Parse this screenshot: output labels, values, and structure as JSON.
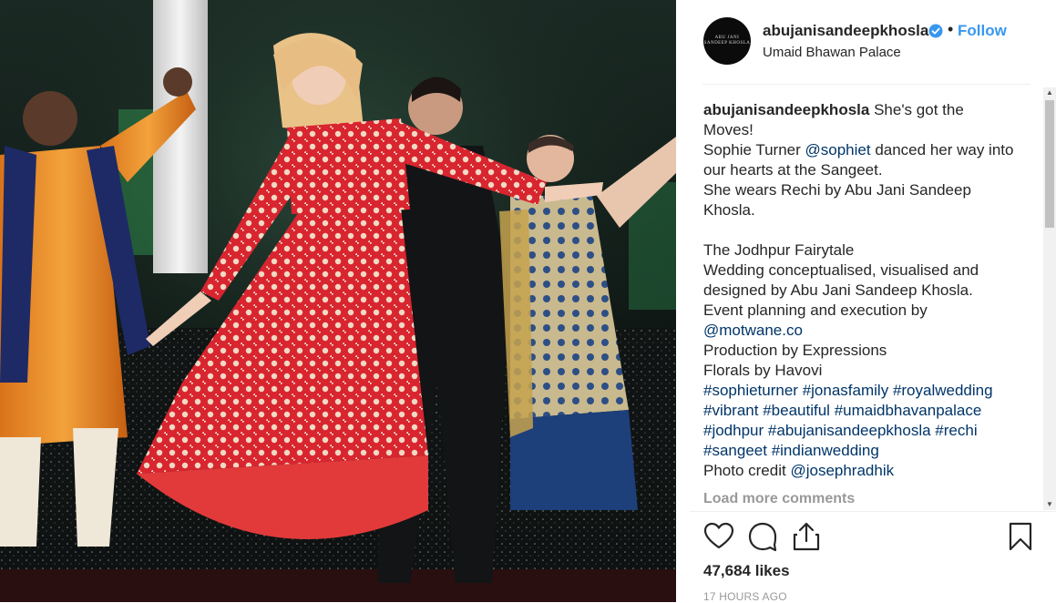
{
  "header": {
    "avatar_text": "ABU JANI SANDEEP KHOSLA",
    "username": "abujanisandeepkhosla",
    "separator": "•",
    "follow_label": "Follow",
    "location": "Umaid Bhawan Palace"
  },
  "caption": {
    "username": "abujanisandeepkhosla",
    "line1": " She's got the Moves!",
    "line2_pre": "Sophie Turner ",
    "mention1": "@sophiet",
    "line2_post": " danced her way into our hearts at the Sangeet.",
    "line3": "She wears Rechi by Abu Jani Sandeep Khosla.",
    "line4": "The Jodhpur Fairytale",
    "line5": "Wedding conceptualised, visualised and designed by Abu Jani Sandeep Khosla.",
    "line6": "Event planning and execution by",
    "mention2": "@motwane.co",
    "line7": "Production by Expressions",
    "line8": "Florals by Havovi",
    "hashtags": [
      "#sophieturner",
      "#jonasfamily",
      "#royalwedding",
      "#vibrant",
      "#beautiful",
      "#umaidbhavanpalace",
      "#jodhpur",
      "#abujanisandeepkhosla",
      "#rechi",
      "#sangeet",
      "#indianwedding"
    ],
    "credit_pre": "Photo credit ",
    "mention3": "@josephradhik"
  },
  "load_more": "Load more comments",
  "likes": "47,684 likes",
  "timestamp": "17 HOURS AGO",
  "icons": {
    "like": "heart-icon",
    "comment": "comment-icon",
    "share": "share-icon",
    "save": "bookmark-icon",
    "verified": "verified-badge-icon"
  },
  "colors": {
    "link": "#003569",
    "follow": "#3897f0",
    "verified": "#3897f0",
    "muted": "#999999",
    "text": "#262626"
  }
}
